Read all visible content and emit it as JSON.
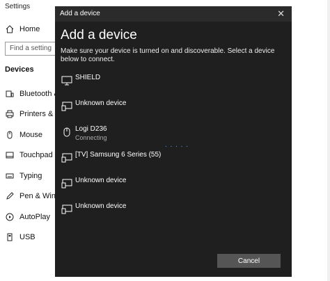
{
  "settings": {
    "title": "Settings",
    "home_label": "Home",
    "search_placeholder": "Find a setting",
    "section_title": "Devices",
    "nav_items": [
      {
        "label": "Bluetooth & o",
        "icon": "bluetooth-devices-icon"
      },
      {
        "label": "Printers & sca",
        "icon": "printer-icon"
      },
      {
        "label": "Mouse",
        "icon": "mouse-icon"
      },
      {
        "label": "Touchpad",
        "icon": "touchpad-icon"
      },
      {
        "label": "Typing",
        "icon": "keyboard-icon"
      },
      {
        "label": "Pen & Window",
        "icon": "pen-icon"
      },
      {
        "label": "AutoPlay",
        "icon": "autoplay-icon"
      },
      {
        "label": "USB",
        "icon": "usb-icon"
      }
    ]
  },
  "dialog": {
    "titlebar": "Add a device",
    "close_label": "✕",
    "heading": "Add a device",
    "description": "Make sure your device is turned on and discoverable. Select a device below to connect.",
    "spinner": ". . . . .",
    "cancel_label": "Cancel",
    "devices": [
      {
        "name": "SHIELD",
        "status": "",
        "icon": "monitor-icon"
      },
      {
        "name": "Unknown device",
        "status": "",
        "icon": "display-device-icon"
      },
      {
        "name": "Logi D236",
        "status": "Connecting",
        "icon": "mouse-icon"
      },
      {
        "name": "[TV] Samsung 6 Series (55)",
        "status": "",
        "icon": "display-device-icon"
      },
      {
        "name": "Unknown device",
        "status": "",
        "icon": "display-device-icon"
      },
      {
        "name": "Unknown device",
        "status": "",
        "icon": "display-device-icon"
      }
    ]
  },
  "colors": {
    "dialog_bg": "#1f1f1f",
    "titlebar_bg": "#2b2b2b",
    "accent": "#4aa3ff",
    "button_bg": "#555555"
  }
}
